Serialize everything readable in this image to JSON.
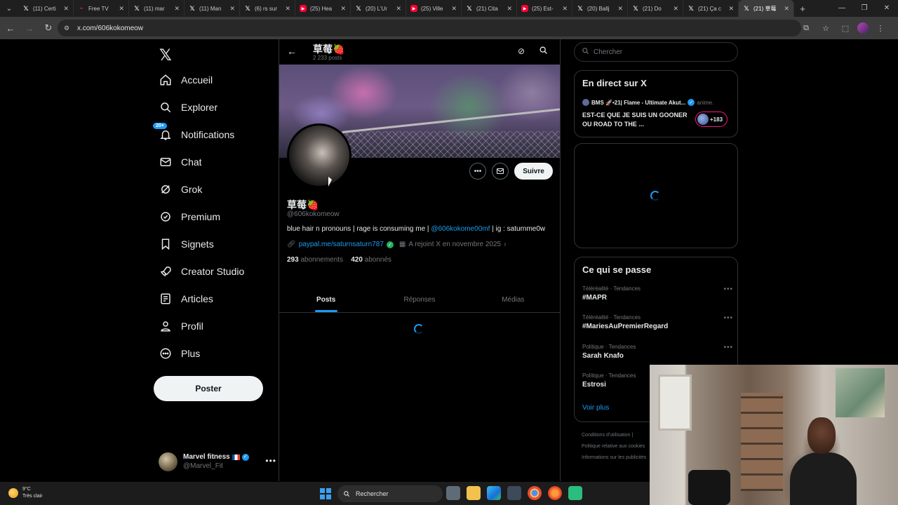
{
  "browser": {
    "tabs": [
      {
        "title": "(11) Certi",
        "favicon": "x-icon"
      },
      {
        "title": "Free TV",
        "favicon": "tv-icon"
      },
      {
        "title": "(11) mar",
        "favicon": "x-icon"
      },
      {
        "title": "(11) Man",
        "favicon": "x-icon"
      },
      {
        "title": "(6) rs sur",
        "favicon": "x-icon"
      },
      {
        "title": "(25) Hea",
        "favicon": "youtube-icon"
      },
      {
        "title": "(20) L'Ur",
        "favicon": "x-icon"
      },
      {
        "title": "(25) Ville",
        "favicon": "youtube-icon"
      },
      {
        "title": "(21) Cita",
        "favicon": "x-icon"
      },
      {
        "title": "(25) Est-",
        "favicon": "youtube-icon"
      },
      {
        "title": "(20) Ballj",
        "favicon": "x-icon"
      },
      {
        "title": "(21) Do",
        "favicon": "x-icon"
      },
      {
        "title": "(21) Ça c",
        "favicon": "x-icon"
      },
      {
        "title": "(21) 草莓",
        "favicon": "x-icon"
      }
    ],
    "active_tab_index": 13,
    "url": "x.com/606kokomeow"
  },
  "nav": {
    "items": [
      {
        "label": "Accueil",
        "icon": "home-icon"
      },
      {
        "label": "Explorer",
        "icon": "search-icon"
      },
      {
        "label": "Notifications",
        "icon": "bell-icon",
        "badge": "20+"
      },
      {
        "label": "Chat",
        "icon": "mail-icon"
      },
      {
        "label": "Grok",
        "icon": "grok-icon"
      },
      {
        "label": "Premium",
        "icon": "verified-icon"
      },
      {
        "label": "Signets",
        "icon": "bookmark-icon"
      },
      {
        "label": "Creator Studio",
        "icon": "rocket-icon"
      },
      {
        "label": "Articles",
        "icon": "article-icon"
      },
      {
        "label": "Profil",
        "icon": "person-icon"
      },
      {
        "label": "Plus",
        "icon": "more-circle-icon"
      }
    ],
    "post_label": "Poster",
    "account": {
      "name": "Marvel fitness",
      "handle": "@Marvel_Fit"
    }
  },
  "profile": {
    "header_name": "草莓🍓",
    "post_count": "2 233 posts",
    "name": "草莓🍓",
    "handle": "@606kokomeow",
    "bio_text": "blue hair n pronouns | rage is consuming me | ",
    "bio_mention": "@606kokome00mf",
    "bio_tail": " | ig : saturnme0w",
    "website": "paypal.me/saturnsaturn787",
    "joined": "A rejoint X en novembre 2025",
    "following_count": "293",
    "following_label": "abonnements",
    "followers_count": "420",
    "followers_label": "abonnés",
    "follow_label": "Suivre",
    "tabs": [
      "Posts",
      "Réponses",
      "Médias"
    ],
    "active_tab": "Posts"
  },
  "sidebar": {
    "search_placeholder": "Chercher",
    "live": {
      "title": "En direct sur X",
      "channel": "BMS 🚀•21| Flame - Ultimate Akut...",
      "category": "anime.",
      "text": "EST-CE QUE JE SUIS UN GOONER OU ROAD TO THE ...",
      "viewers": "+183"
    },
    "trends": {
      "title": "Ce qui se passe",
      "items": [
        {
          "category": "Téléréalité · Tendances",
          "name": "#MAPR"
        },
        {
          "category": "Téléréalité · Tendances",
          "name": "#MariesAuPremierRegard"
        },
        {
          "category": "Politique · Tendances",
          "name": "Sarah Knafo"
        },
        {
          "category": "Politique · Tendances",
          "name": "Estrosi"
        }
      ],
      "see_more": "Voir plus"
    },
    "footer": [
      "Conditions d'utilisation |",
      "Politique relative aux cookies",
      "Informations sur les publicités"
    ]
  },
  "taskbar": {
    "temperature": "9°C",
    "condition": "Très clair",
    "search_label": "Rechercher"
  },
  "colors": {
    "accent": "#1d9bf0",
    "background": "#000000",
    "border": "#2f3336",
    "muted": "#71767b"
  }
}
